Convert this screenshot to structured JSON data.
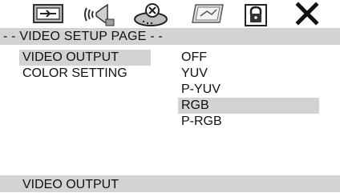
{
  "toolbar": {
    "icons": [
      {
        "name": "general-setup-icon"
      },
      {
        "name": "audio-setup-icon"
      },
      {
        "name": "dolby-setup-icon"
      },
      {
        "name": "video-setup-icon"
      },
      {
        "name": "preference-lock-icon"
      },
      {
        "name": "exit-icon"
      }
    ]
  },
  "page": {
    "title": "- - VIDEO SETUP PAGE - -"
  },
  "menu": {
    "items": [
      {
        "label": "VIDEO OUTPUT",
        "selected": true
      },
      {
        "label": "COLOR SETTING",
        "selected": false
      }
    ]
  },
  "options": {
    "items": [
      {
        "label": "OFF",
        "selected": false
      },
      {
        "label": "YUV",
        "selected": false
      },
      {
        "label": "P-YUV",
        "selected": false
      },
      {
        "label": "RGB",
        "selected": true
      },
      {
        "label": "P-RGB",
        "selected": false
      }
    ]
  },
  "status": {
    "text": "VIDEO OUTPUT"
  },
  "colors": {
    "highlight": "#d3d3d3",
    "text": "#111111",
    "background": "#ffffff"
  }
}
